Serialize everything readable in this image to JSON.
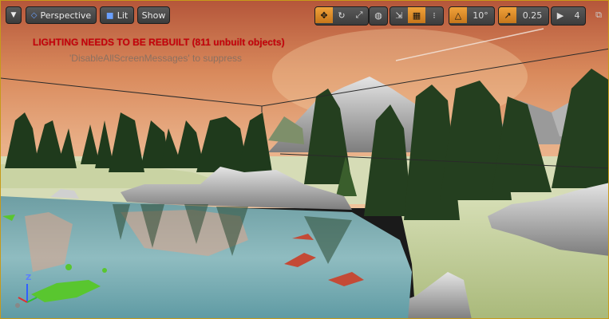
{
  "toolbar": {
    "menu_icon": "chevron-down-icon",
    "view_mode": "Perspective",
    "lighting_mode": "Lit",
    "show_label": "Show",
    "rotation_snap": "10°",
    "scale_snap": "0.25",
    "camera_speed": "4"
  },
  "messages": {
    "error": "LIGHTING NEEDS TO BE REBUILT (811 unbuilt objects)",
    "suppress_hint": "'DisableAllScreenMessages' to suppress"
  },
  "axis": {
    "z_label": "Z",
    "x_label": "X"
  },
  "colors": {
    "accent": "#e8962a",
    "error": "#c8000a"
  }
}
